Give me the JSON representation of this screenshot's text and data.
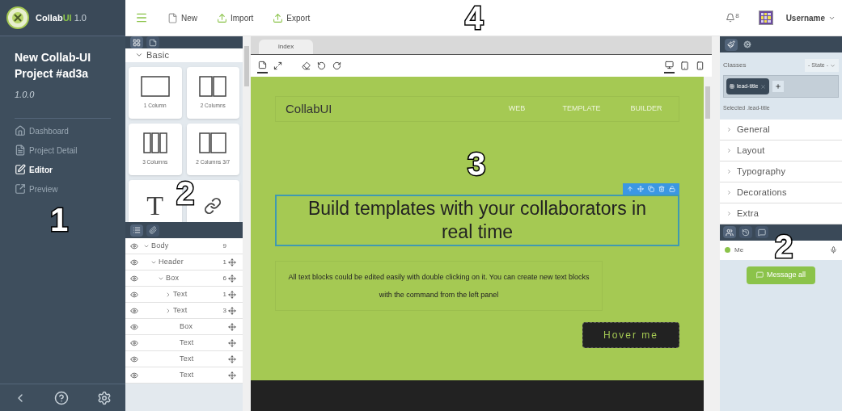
{
  "app": {
    "name": "Collab",
    "name_highlight": "UI",
    "version": "1.0"
  },
  "project": {
    "title": "New Collab-UI Project #ad3a",
    "version": "1.0.0"
  },
  "nav": [
    {
      "label": "Dashboard",
      "kind": "home",
      "selected": false
    },
    {
      "label": "Project Detail",
      "kind": "doc",
      "selected": false
    },
    {
      "label": "Editor",
      "kind": "edit",
      "selected": true
    },
    {
      "label": "Preview",
      "kind": "preview",
      "selected": false
    }
  ],
  "toolbar": {
    "actions": [
      {
        "label": "New",
        "kind": "new"
      },
      {
        "label": "Import",
        "kind": "import"
      },
      {
        "label": "Export",
        "kind": "export"
      }
    ],
    "notifications": "8",
    "user": "Username"
  },
  "blocks": {
    "tabs": [
      {
        "kind": "blocks",
        "selected": true
      },
      {
        "kind": "pages",
        "selected": false
      }
    ],
    "category": "Basic",
    "expanded": true,
    "items": [
      {
        "label": "1 Column",
        "kind": "col1"
      },
      {
        "label": "2 Columns",
        "kind": "col2"
      },
      {
        "label": "3 Columns",
        "kind": "col3"
      },
      {
        "label": "2 Columns 3/7",
        "kind": "col37"
      },
      {
        "kind": "text",
        "glyph": "T"
      },
      {
        "kind": "link"
      }
    ]
  },
  "layers": {
    "tabs": [
      {
        "kind": "layers",
        "selected": true
      },
      {
        "kind": "assets",
        "selected": false
      }
    ],
    "items": [
      {
        "name": "Body",
        "count": "9",
        "expanded": true,
        "movable": false,
        "children": [
          {
            "name": "Header",
            "count": "1",
            "expanded": true,
            "movable": true,
            "children": [
              {
                "name": "Box",
                "count": "6",
                "expanded": true,
                "movable": true,
                "children": [
                  {
                    "name": "Text",
                    "count": "1",
                    "expanded": false,
                    "movable": true
                  },
                  {
                    "name": "Text",
                    "count": "3",
                    "expanded": false,
                    "movable": true
                  },
                  {
                    "name": "Box",
                    "movable": true
                  },
                  {
                    "name": "Text",
                    "movable": true
                  },
                  {
                    "name": "Text",
                    "movable": true
                  },
                  {
                    "name": "Text",
                    "movable": true
                  }
                ]
              }
            ]
          }
        ]
      }
    ]
  },
  "canvas": {
    "tabs": [
      {
        "label": "index",
        "selected": true
      }
    ],
    "tools": [
      {
        "kind": "outline",
        "selected": true
      },
      {
        "kind": "fullscreen",
        "selected": false
      },
      {
        "kind": "eraser",
        "selected": false
      },
      {
        "kind": "undo",
        "selected": false
      },
      {
        "kind": "redo",
        "selected": false
      }
    ],
    "devices": [
      {
        "kind": "desktop",
        "selected": true
      },
      {
        "kind": "tablet",
        "selected": false
      },
      {
        "kind": "mobile",
        "selected": false
      }
    ],
    "page": {
      "brand": "CollabUI",
      "menu": [
        "WEB",
        "TEMPLATE",
        "BUILDER"
      ],
      "heading": "Build templates with your collaborators in real time",
      "paragraph": "All text blocks could be edited easily with double clicking on it. You can create new text blocks with the command from the left panel",
      "button": "Hover me"
    }
  },
  "style_manager": {
    "tabs": [
      {
        "kind": "style",
        "selected": true
      },
      {
        "kind": "settings",
        "selected": false
      }
    ],
    "classes_label": "Classes",
    "state_placeholder": "- State -",
    "classes": [
      {
        "label": "lead-title",
        "active": true
      }
    ],
    "selected_text": "Selected .lead-title",
    "sectors": [
      {
        "label": "General",
        "expanded": false
      },
      {
        "label": "Layout",
        "expanded": false
      },
      {
        "label": "Typography",
        "expanded": false
      },
      {
        "label": "Decorations",
        "expanded": false
      },
      {
        "label": "Extra",
        "expanded": false
      }
    ]
  },
  "collab": {
    "tabs": [
      {
        "kind": "users",
        "selected": true
      },
      {
        "kind": "history",
        "selected": false
      },
      {
        "kind": "chat",
        "selected": false
      }
    ],
    "users": [
      {
        "name": "Me",
        "color": "#8bc34a"
      }
    ],
    "message_button": "Message all"
  },
  "annotations": {
    "sidebar": "1",
    "blocks": "2",
    "canvas": "3",
    "topbar": "4",
    "right_panel": "2"
  }
}
